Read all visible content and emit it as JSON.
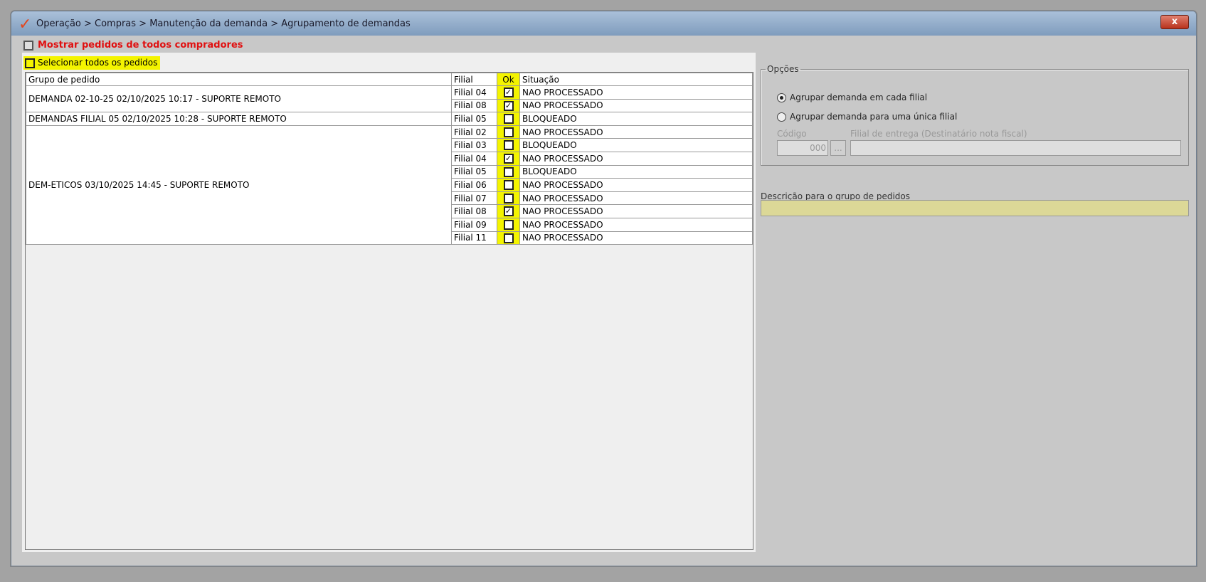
{
  "window": {
    "title": "Operação > Compras > Manutenção da demanda > Agrupamento de demandas",
    "close": "x"
  },
  "show_all_buyers": {
    "label": "Mostrar pedidos de todos compradores",
    "checked": false
  },
  "select_all": {
    "label": "Selecionar todos os pedidos",
    "checked": false
  },
  "grid": {
    "headers": {
      "group": "Grupo de pedido",
      "filial": "Filial",
      "ok": "Ok",
      "status": "Situação"
    },
    "groups": [
      {
        "name": "DEMANDA 02-10-25 02/10/2025 10:17 - SUPORTE REMOTO",
        "rows": [
          {
            "filial": "Filial 04",
            "ok": true,
            "status": "NAO PROCESSADO"
          },
          {
            "filial": "Filial 08",
            "ok": true,
            "status": "NAO PROCESSADO"
          }
        ]
      },
      {
        "name": "DEMANDAS FILIAL 05 02/10/2025 10:28 - SUPORTE REMOTO",
        "rows": [
          {
            "filial": "Filial 05",
            "ok": false,
            "status": "BLOQUEADO"
          }
        ]
      },
      {
        "name": "DEM-ETICOS 03/10/2025 14:45 - SUPORTE REMOTO",
        "rows": [
          {
            "filial": "Filial 02",
            "ok": false,
            "status": "NAO PROCESSADO"
          },
          {
            "filial": "Filial 03",
            "ok": false,
            "status": "BLOQUEADO"
          },
          {
            "filial": "Filial 04",
            "ok": true,
            "status": "NAO PROCESSADO"
          },
          {
            "filial": "Filial 05",
            "ok": false,
            "status": "BLOQUEADO"
          },
          {
            "filial": "Filial 06",
            "ok": false,
            "status": "NAO PROCESSADO"
          },
          {
            "filial": "Filial 07",
            "ok": false,
            "status": "NAO PROCESSADO"
          },
          {
            "filial": "Filial 08",
            "ok": true,
            "status": "NAO PROCESSADO"
          },
          {
            "filial": "Filial 09",
            "ok": false,
            "status": "NAO PROCESSADO"
          },
          {
            "filial": "Filial 11",
            "ok": false,
            "status": "NAO PROCESSADO"
          }
        ]
      }
    ]
  },
  "options": {
    "legend": "Opções",
    "radio1": "Agrupar demanda em cada filial",
    "radio2": "Agrupar demanda para uma única filial",
    "selected": 1,
    "codigo_label": "Código",
    "codigo_value": "000",
    "lookup_button": "...",
    "filial_label": "Filial de entrega (Destinatário nota fiscal)",
    "filial_value": ""
  },
  "description": {
    "label": "Descrição para o grupo de pedidos",
    "value": ""
  }
}
